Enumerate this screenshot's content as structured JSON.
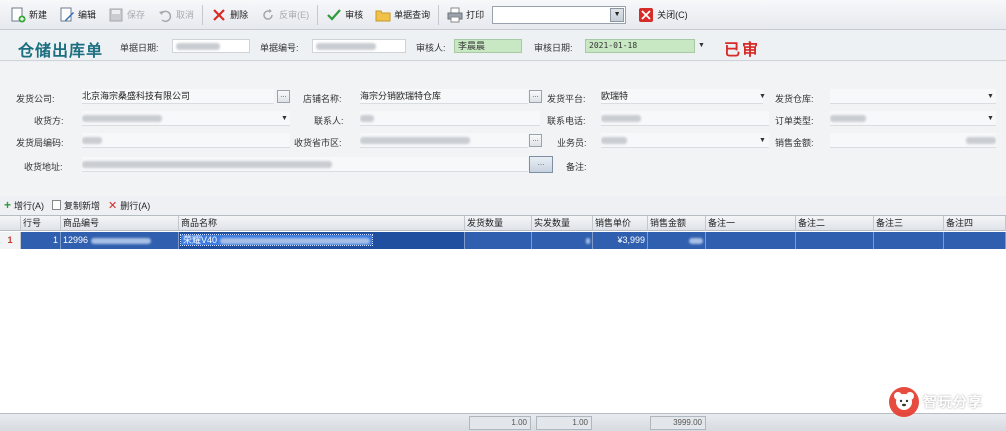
{
  "toolbar": {
    "new": "新建",
    "edit": "编辑",
    "save": "保存",
    "undo": "取消",
    "delete": "删除",
    "reverse_audit": "反审(E)",
    "audit": "审核",
    "doc_query": "单据查询",
    "print": "打印",
    "print_template": "",
    "close": "关闭(C)"
  },
  "header": {
    "title": "仓储出库单",
    "doc_date_label": "单据日期:",
    "doc_no_label": "单据编号:",
    "auditor_label": "审核人:",
    "auditor_value": "李晨晨",
    "audit_date_label": "审核日期:",
    "audit_date_value": "2021-01-18",
    "status": "已审"
  },
  "form": {
    "ship_company_label": "发货公司:",
    "ship_company_value": "北京海宗桑盛科技有限公司",
    "store_name_label": "店铺名称:",
    "store_name_value": "海宗分销欧瑞特仓库",
    "ship_platform_label": "发货平台:",
    "ship_platform_value": "欧瑞特",
    "ship_warehouse_label": "发货仓库:",
    "receiver_label": "收货方:",
    "contact_label": "联系人:",
    "contact_phone_label": "联系电话:",
    "order_type_label": "订单类型:",
    "ship_code_label": "发货局编码:",
    "ship_region_label": "收货省市区:",
    "salesman_label": "业务员:",
    "sales_amount_label": "销售金额:",
    "ship_address_label": "收货地址:",
    "remark_label": "备注:"
  },
  "rowbar": {
    "add_row": "增行(A)",
    "copy_add": "复制新增",
    "delete_row": "删行(A)"
  },
  "grid": {
    "headers": [
      "行号",
      "商品编号",
      "商品名称",
      "发货数量",
      "实发数量",
      "销售单价",
      "销售金额",
      "备注一",
      "备注二",
      "备注三",
      "备注四"
    ],
    "rows": [
      {
        "indicator": "1",
        "line_no": "1",
        "code": "12996",
        "name": "荣耀V40",
        "unit_price": "¥3,999"
      }
    ]
  },
  "footer": {
    "t1": "1.00",
    "t2": "1.00",
    "t3": "3999.00"
  },
  "watermark": {
    "text": "智玩分享"
  }
}
